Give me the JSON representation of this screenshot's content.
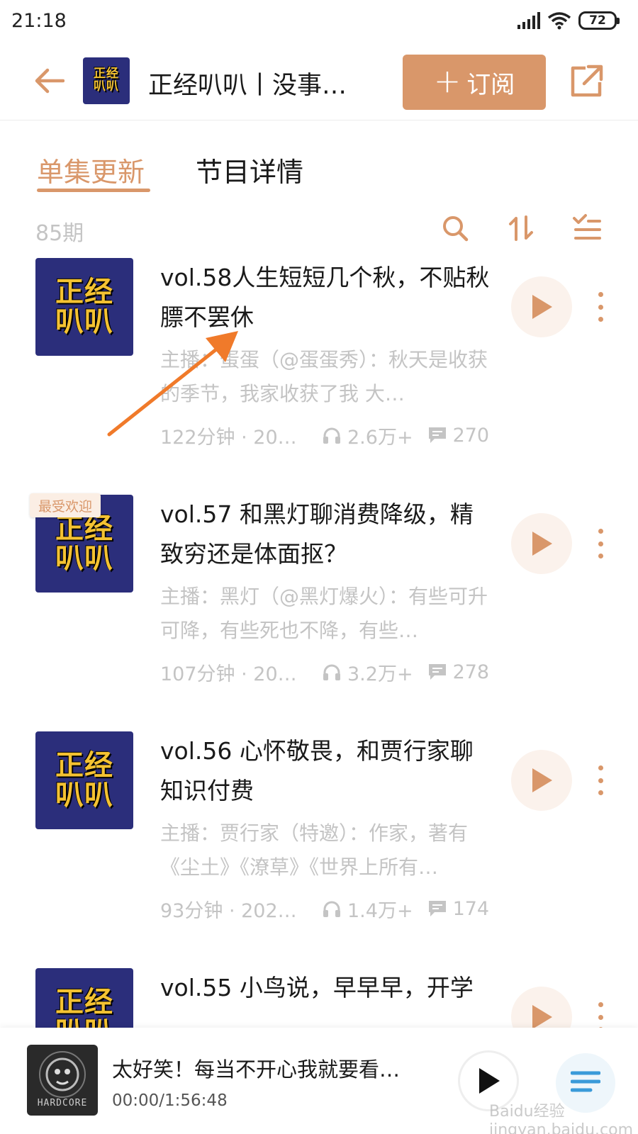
{
  "status_bar": {
    "time": "21:18",
    "battery": "72"
  },
  "header": {
    "title": "正经叭叭丨没事…",
    "subscribe_label": "订阅",
    "cover_line1": "正经",
    "cover_line2": "叭叭"
  },
  "tabs": [
    {
      "label": "单集更新",
      "active": true
    },
    {
      "label": "节目详情",
      "active": false
    }
  ],
  "list": {
    "count_label": "85期"
  },
  "episodes": [
    {
      "title": "vol.58人生短短几个秋，不贴秋膘不罢休",
      "description": "主播：蛋蛋（@蛋蛋秀）：秋天是收获的季节，我家收获了我 大…",
      "duration": "122分钟 · 202…",
      "plays": "2.6万+",
      "comments": "270",
      "badge": ""
    },
    {
      "title": "vol.57 和黑灯聊消费降级，精致穷还是体面抠？",
      "description": "主播：黑灯（@黑灯爆火）：有些可升可降，有些死也不降，有些…",
      "duration": "107分钟 · 202…",
      "plays": "3.2万+",
      "comments": "278",
      "badge": "最受欢迎"
    },
    {
      "title": "vol.56 心怀敬畏，和贾行家聊知识付费",
      "description": "主播：贾行家（特邀）：作家，著有《尘土》《潦草》《世界上所有…",
      "duration": "93分钟 · 2022…",
      "plays": "1.4万+",
      "comments": "174",
      "badge": ""
    },
    {
      "title": "vol.55 小鸟说，早早早，开学",
      "description": "",
      "duration": "",
      "plays": "",
      "comments": "",
      "badge": ""
    }
  ],
  "mini_player": {
    "title": "太好笑！每当不开心我就要看…",
    "time": "00:00/1:56:48",
    "cover_text": "HARDCORE"
  },
  "watermark": "Baidu经验 jingyan.baidu.com",
  "colors": {
    "accent": "#d9976a",
    "cover_bg": "#2b2e7b",
    "cover_text": "#f4c232",
    "muted_text": "#c4c4c4",
    "arrow": "#f07a2a"
  }
}
